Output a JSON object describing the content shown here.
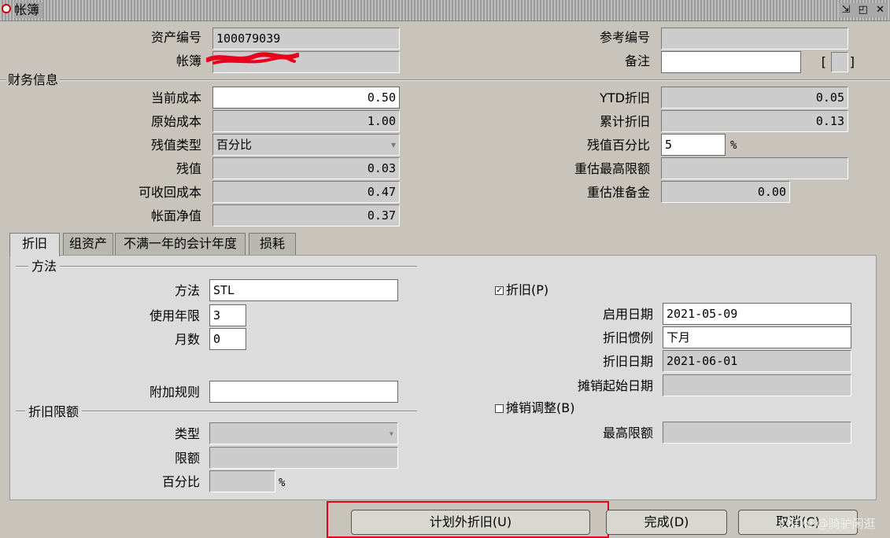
{
  "window": {
    "title": "帐簿",
    "controls": "⇲ ◰ ✕"
  },
  "header": {
    "asset_number_label": "资产编号",
    "asset_number_value": "100079039",
    "book_label": "帐簿",
    "reference_label": "参考编号",
    "reference_value": "",
    "comment_label": "备注",
    "comment_value": "",
    "bracket_left": "[",
    "bracket_right": "]"
  },
  "financial": {
    "section_title": "财务信息",
    "current_cost_label": "当前成本",
    "current_cost": "0.50",
    "original_cost_label": "原始成本",
    "original_cost": "1.00",
    "salvage_type_label": "残值类型",
    "salvage_type": "百分比",
    "salvage_value_label": "残值",
    "salvage_value": "0.03",
    "recoverable_cost_label": "可收回成本",
    "recoverable_cost": "0.47",
    "net_book_value_label": "帐面净值",
    "net_book_value": "0.37",
    "ytd_depr_label": "YTD折旧",
    "ytd_depr": "0.05",
    "accum_depr_label": "累计折旧",
    "accum_depr": "0.13",
    "salvage_pct_label": "残值百分比",
    "salvage_pct": "5",
    "pct_sign": "%",
    "reval_ceiling_label": "重估最高限额",
    "reval_ceiling": "",
    "reval_reserve_label": "重估准备金",
    "reval_reserve": "0.00"
  },
  "tabs": [
    {
      "label": "折旧",
      "active": true
    },
    {
      "label": "组资产",
      "active": false
    },
    {
      "label": "不满一年的会计年度",
      "active": false
    },
    {
      "label": "损耗",
      "active": false
    }
  ],
  "method": {
    "section_title": "方法",
    "method_label": "方法",
    "method_value": "STL",
    "life_years_label": "使用年限",
    "life_years": "3",
    "months_label": "月数",
    "months": "0",
    "bonus_rule_label": "附加规则",
    "bonus_rule": ""
  },
  "depr_limit": {
    "section_title": "折旧限额",
    "type_label": "类型",
    "type_value": "",
    "amount_label": "限额",
    "amount_value": "",
    "percent_label": "百分比",
    "percent_value": "",
    "pct_sign": "%"
  },
  "depr_right": {
    "depreciate_checkbox_label": "折旧(P)",
    "depreciate_checked": true,
    "in_service_date_label": "启用日期",
    "in_service_date": "2021-05-09",
    "prorate_convention_label": "折旧惯例",
    "prorate_convention": "下月",
    "prorate_date_label": "折旧日期",
    "prorate_date": "2021-06-01",
    "amort_start_label": "摊销起始日期",
    "amort_start": "",
    "amortize_adj_label": "摊销调整(B)",
    "amortize_adj_checked": false,
    "ceiling_label": "最高限额",
    "ceiling_value": ""
  },
  "buttons": {
    "unplanned_depr": "计划外折旧(U)",
    "done": "完成(D)",
    "cancel": "取消(C)"
  },
  "watermark": "CSDN @骑驴闲逛",
  "colors": {
    "window_bg": "#c8c4bc",
    "panel_bg": "#dcdcdc",
    "highlight_box": "#e0001a",
    "redaction": "#e8001c"
  }
}
